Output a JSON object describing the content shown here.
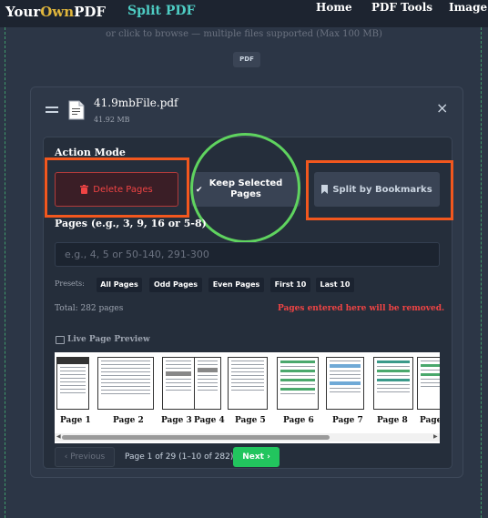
{
  "header": {
    "brand_prefix": "Your",
    "brand_accent": "Own",
    "brand_suffix": "PDF",
    "tool_name": "Split PDF",
    "nav": [
      "Home",
      "PDF Tools",
      "Image T"
    ]
  },
  "upload": {
    "hint": "or click to browse — multiple files supported (Max 100 MB)",
    "badge": "PDF"
  },
  "file": {
    "name": "41.9mbFile.pdf",
    "size": "41.92 MB",
    "close_icon": "×"
  },
  "action_mode": {
    "title": "Action Mode",
    "delete_label": "Delete Pages",
    "keep_label": "Keep Selected Pages",
    "split_label": "Split by Bookmarks",
    "selected": "keep"
  },
  "pages": {
    "label": "Pages (e.g., 3, 9, 16 or 5-8)",
    "placeholder": "e.g., 4, 5 or 50-140, 291-300",
    "value": ""
  },
  "presets": {
    "label": "Presets:",
    "items": [
      "All Pages",
      "Odd Pages",
      "Even Pages",
      "First 10",
      "Last 10"
    ]
  },
  "summary": {
    "total": "Total: 282 pages",
    "warning": "Pages entered here will be removed."
  },
  "preview": {
    "title": "Live Page Preview",
    "pages": [
      "Page 1",
      "Page 2",
      "Page 3",
      "Page 4",
      "Page 5",
      "Page 6",
      "Page 7",
      "Page 8",
      "Page"
    ]
  },
  "pagination": {
    "prev_label": "Previous",
    "info": "Page 1 of 29 (1–10 of 282)",
    "next_label": "Next"
  },
  "colors": {
    "accent_teal": "#4ecdc4",
    "brand_gold": "#e0b63c",
    "danger": "#ef4444",
    "success": "#22c55e",
    "annotation_orange": "#f2571e",
    "annotation_green": "#5fd35f"
  }
}
